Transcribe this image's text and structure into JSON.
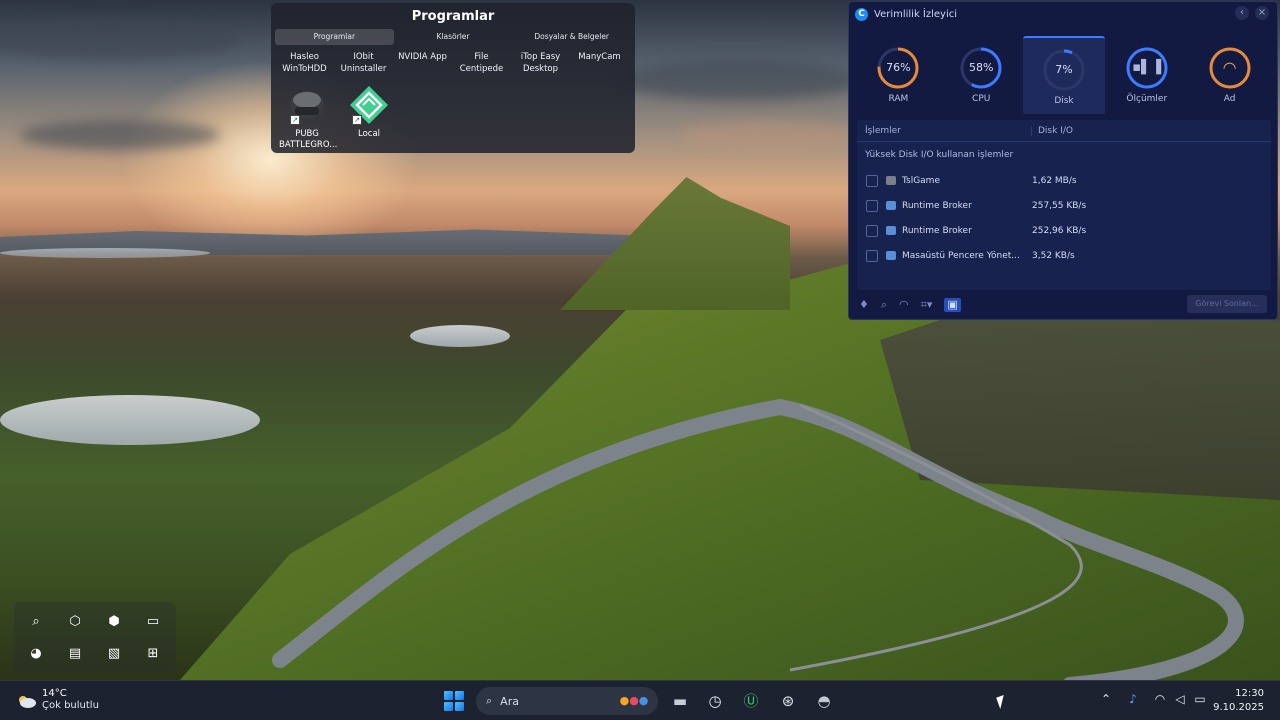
{
  "fence": {
    "title": "Programlar",
    "tabs": [
      "Programlar",
      "Klasörler",
      "Dosyalar & Belgeler"
    ],
    "items": [
      {
        "line1": "Hasleo",
        "line2": "WinToHDD"
      },
      {
        "line1": "IObit",
        "line2": "Uninstaller"
      },
      {
        "line1": "NVIDIA App",
        "line2": ""
      },
      {
        "line1": "File",
        "line2": "Centipede"
      },
      {
        "line1": "iTop Easy",
        "line2": "Desktop"
      },
      {
        "line1": "ManyCam",
        "line2": ""
      }
    ],
    "icons": [
      {
        "line1": "PUBG",
        "line2": "BATTLEGRO...",
        "icon": "pubg-helmet-icon"
      },
      {
        "line1": "Local",
        "line2": "",
        "icon": "local-app-icon"
      }
    ]
  },
  "monitor": {
    "title": "Verimlilik İzleyici",
    "tabs": [
      {
        "label": "RAM",
        "value": "76%",
        "percent": 76,
        "color": "#e58a3a"
      },
      {
        "label": "CPU",
        "value": "58%",
        "percent": 58,
        "color": "#3e7bff"
      },
      {
        "label": "Disk",
        "value": "7%",
        "percent": 7,
        "color": "#3e7bff"
      },
      {
        "label": "Ölçümler",
        "value": "",
        "percent": 0,
        "color": "#3e7bff"
      },
      {
        "label": "Ad",
        "value": "",
        "percent": 0,
        "color": "#e58a3a"
      }
    ],
    "active_tab": "Disk",
    "col_process": "İşlemler",
    "col_disk": "Disk I/O",
    "subtitle": "Yüksek Disk I/O kullanan işlemler",
    "rows": [
      {
        "name": "TslGame",
        "value": "1,62 MB/s"
      },
      {
        "name": "Runtime Broker",
        "value": "257,55 KB/s"
      },
      {
        "name": "Runtime Broker",
        "value": "252,96 KB/s"
      },
      {
        "name": "Masaüstü Pencere Yönet...",
        "value": "3,52 KB/s"
      }
    ],
    "end_task": "Görevi Sonlan..."
  },
  "taskbar": {
    "temperature": "14°C",
    "weather": "Çok bulutlu",
    "search_placeholder": "Ara",
    "time": "12:30",
    "date": "9.10.2025"
  }
}
